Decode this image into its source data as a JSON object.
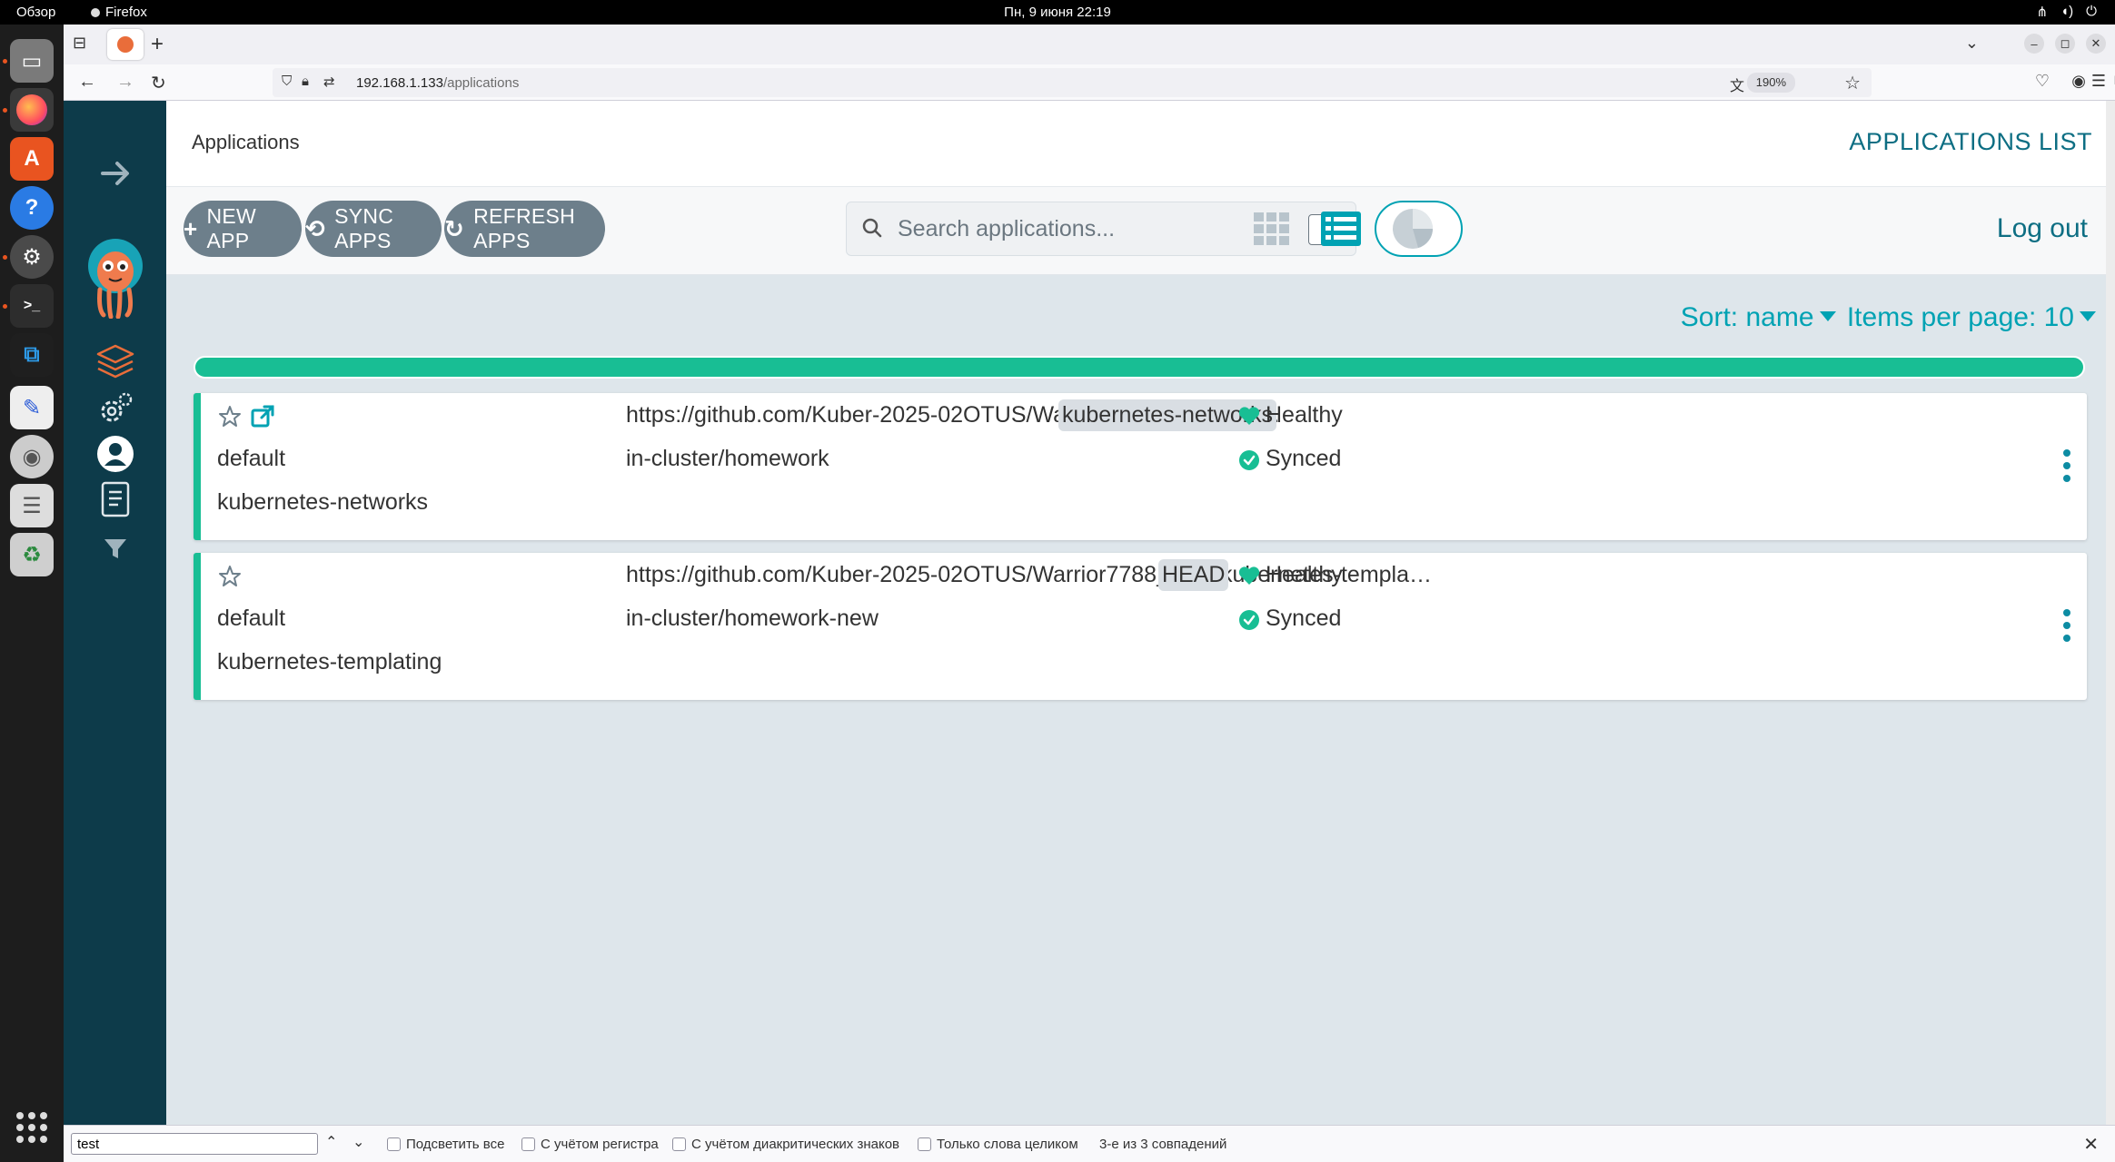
{
  "system": {
    "overview_label": "Обзор",
    "active_app": "Firefox",
    "clock": "Пн, 9 июня  22:19"
  },
  "browser": {
    "url_host": "192.168.1.133",
    "url_path": "/applications",
    "zoom": "190%"
  },
  "header": {
    "title": "Applications",
    "breadcrumb": "APPLICATIONS LIST"
  },
  "toolbar": {
    "new_app": "NEW APP",
    "sync_apps": "SYNC APPS",
    "refresh_apps": "REFRESH APPS",
    "search_placeholder": "Search applications...",
    "search_shortcut": "/",
    "logout": "Log out"
  },
  "sort": {
    "sort_label": "Sort: name",
    "items_label": "Items per page: 10"
  },
  "colors": {
    "accent": "#00a2b3",
    "healthy": "#18be94",
    "nav_bg": "#0d3b4a"
  },
  "apps": [
    {
      "repo": "https://github.com/Kuber-2025-02OTUS/Warrior7788_repo/kub…",
      "target_revision": "kubernetes-networks",
      "project": "default",
      "destination": "in-cluster/homework",
      "name": "kubernetes-networks",
      "health": "Healthy",
      "sync": "Synced"
    },
    {
      "repo": "https://github.com/Kuber-2025-02OTUS/Warrior7788_repo/kubernetes-templa…",
      "target_revision": "HEAD",
      "project": "default",
      "destination": "in-cluster/homework-new",
      "name": "kubernetes-templating",
      "health": "Healthy",
      "sync": "Synced"
    }
  ],
  "findbar": {
    "query": "test",
    "highlight_all": "Подсветить все",
    "match_case": "С учётом регистра",
    "match_diacritics": "С учётом диакритических знаков",
    "whole_words": "Только слова целиком",
    "result": "3-е из 3 совпадений"
  }
}
